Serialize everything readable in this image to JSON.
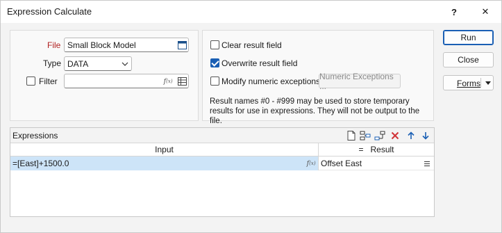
{
  "window": {
    "title": "Expression Calculate",
    "help_label": "?",
    "close_label": "✕"
  },
  "form": {
    "file_label": "File",
    "file_value": "Small Block Model",
    "type_label": "Type",
    "type_value": "DATA",
    "filter_label": "Filter",
    "filter_value": "",
    "fx_symbol": "f(x)",
    "filter_checked": false
  },
  "options": {
    "clear_result_label": "Clear result field",
    "clear_result_checked": false,
    "overwrite_result_label": "Overwrite result field",
    "overwrite_result_checked": true,
    "modify_numeric_label": "Modify numeric exceptions",
    "modify_numeric_checked": false,
    "numeric_exceptions_button": "Numeric Exceptions ...",
    "info_text": "Result names #0 - #999 may be used to store temporary results for use in expressions. They will not be output to the file."
  },
  "buttons": {
    "run": "Run",
    "close": "Close",
    "forms": "Forms"
  },
  "expressions": {
    "title": "Expressions",
    "columns": {
      "input": "Input",
      "result": "=   Result"
    },
    "rows": [
      {
        "input": "=[East]+1500.0",
        "result": "Offset East"
      }
    ],
    "toolbar_icons": [
      "new-row-icon",
      "insert-row-icon",
      "append-row-icon",
      "delete-row-icon",
      "move-up-icon",
      "move-down-icon"
    ]
  }
}
